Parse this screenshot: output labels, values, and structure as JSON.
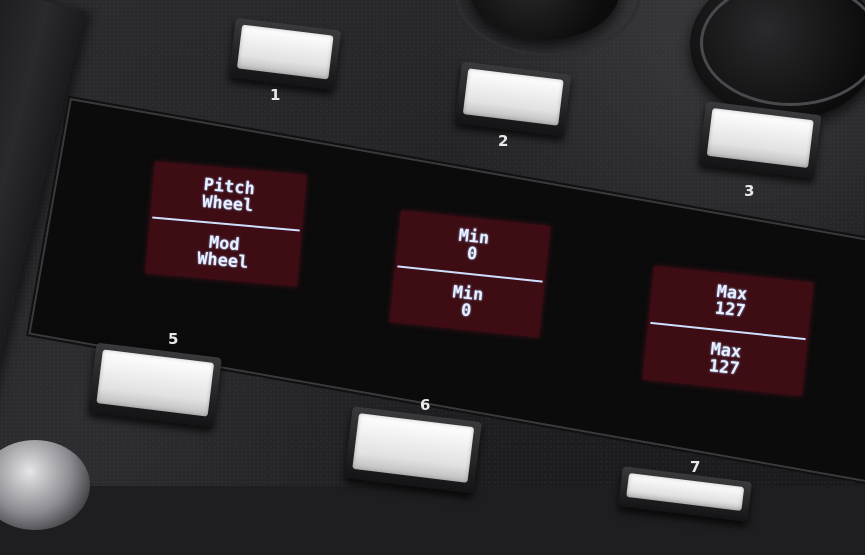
{
  "buttons": [
    {
      "number": "1"
    },
    {
      "number": "2"
    },
    {
      "number": "3"
    },
    {
      "number": "5"
    },
    {
      "number": "6"
    },
    {
      "number": "7"
    }
  ],
  "displays": [
    {
      "top_line1": "Pitch",
      "top_line2": "Wheel",
      "bottom_line1": "Mod",
      "bottom_line2": "Wheel"
    },
    {
      "top_line1": "Min",
      "top_line2": "0",
      "bottom_line1": "Min",
      "bottom_line2": "0"
    },
    {
      "top_line1": "Max",
      "top_line2": "127",
      "bottom_line1": "Max",
      "bottom_line2": "127"
    }
  ],
  "colors": {
    "oled_background": "#3e0d14",
    "oled_text": "#e8f1ff",
    "panel": "#222225",
    "button_cap": "#f2f2f2"
  },
  "icons": [
    "rotary-knob",
    "rotary-knob"
  ]
}
